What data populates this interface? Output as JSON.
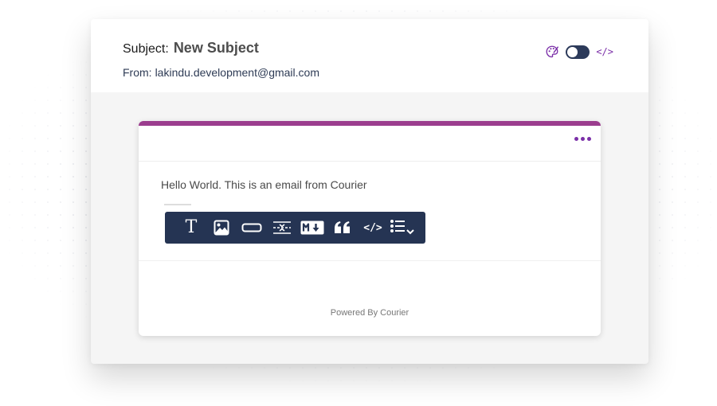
{
  "header": {
    "subject_label": "Subject:",
    "subject_value": "New Subject",
    "from_label": "From:",
    "from_value": "lakindu.development@gmail.com",
    "code_toggle_label": "</>"
  },
  "card": {
    "body_text": "Hello World. This is an email from Courier",
    "powered_by": "Powered By Courier"
  },
  "toolbar": {
    "buttons": [
      {
        "name": "text-block",
        "icon": "text-icon",
        "label": "T"
      },
      {
        "name": "image-block",
        "icon": "image-icon"
      },
      {
        "name": "action-block",
        "icon": "button-icon"
      },
      {
        "name": "divider-block",
        "icon": "divider-icon"
      },
      {
        "name": "markdown-block",
        "icon": "markdown-icon"
      },
      {
        "name": "quote-block",
        "icon": "quote-icon"
      },
      {
        "name": "html-block",
        "icon": "code-icon",
        "label": "</>"
      },
      {
        "name": "list-block",
        "icon": "list-icon"
      }
    ]
  },
  "colors": {
    "accent": "#9b3d8e",
    "purple": "#7b2fa8",
    "toolbar_bg": "#253453",
    "toggle_bg": "#2c3a5a"
  }
}
